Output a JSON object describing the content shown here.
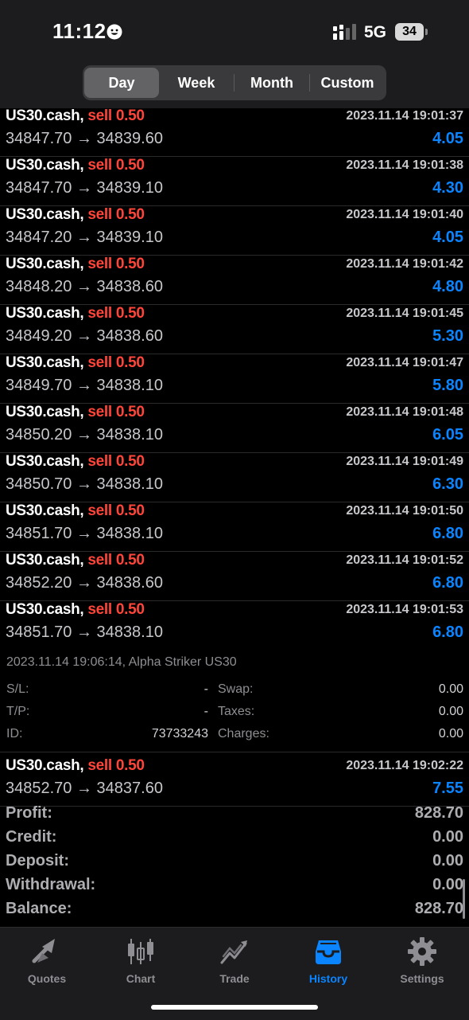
{
  "status_bar": {
    "time": "11:12",
    "network": "5G",
    "battery": "34"
  },
  "tabs": [
    {
      "label": "Day",
      "active": true
    },
    {
      "label": "Week",
      "active": false
    },
    {
      "label": "Month",
      "active": false
    },
    {
      "label": "Custom",
      "active": false
    }
  ],
  "deals": [
    {
      "symbol": "US30.cash,",
      "side": "sell 0.50",
      "time": "2023.11.14 19:01:37",
      "prices": "34847.70 → 34839.60",
      "profit": "4.05"
    },
    {
      "symbol": "US30.cash,",
      "side": "sell 0.50",
      "time": "2023.11.14 19:01:38",
      "prices": "34847.70 → 34839.10",
      "profit": "4.30"
    },
    {
      "symbol": "US30.cash,",
      "side": "sell 0.50",
      "time": "2023.11.14 19:01:40",
      "prices": "34847.20 → 34839.10",
      "profit": "4.05"
    },
    {
      "symbol": "US30.cash,",
      "side": "sell 0.50",
      "time": "2023.11.14 19:01:42",
      "prices": "34848.20 → 34838.60",
      "profit": "4.80"
    },
    {
      "symbol": "US30.cash,",
      "side": "sell 0.50",
      "time": "2023.11.14 19:01:45",
      "prices": "34849.20 → 34838.60",
      "profit": "5.30"
    },
    {
      "symbol": "US30.cash,",
      "side": "sell 0.50",
      "time": "2023.11.14 19:01:47",
      "prices": "34849.70 → 34838.10",
      "profit": "5.80"
    },
    {
      "symbol": "US30.cash,",
      "side": "sell 0.50",
      "time": "2023.11.14 19:01:48",
      "prices": "34850.20 → 34838.10",
      "profit": "6.05"
    },
    {
      "symbol": "US30.cash,",
      "side": "sell 0.50",
      "time": "2023.11.14 19:01:49",
      "prices": "34850.70 → 34838.10",
      "profit": "6.30"
    },
    {
      "symbol": "US30.cash,",
      "side": "sell 0.50",
      "time": "2023.11.14 19:01:50",
      "prices": "34851.70 → 34838.10",
      "profit": "6.80"
    },
    {
      "symbol": "US30.cash,",
      "side": "sell 0.50",
      "time": "2023.11.14 19:01:52",
      "prices": "34852.20 → 34838.60",
      "profit": "6.80"
    },
    {
      "symbol": "US30.cash,",
      "side": "sell 0.50",
      "time": "2023.11.14 19:01:53",
      "prices": "34851.70 → 34838.10",
      "profit": "6.80"
    }
  ],
  "details": {
    "line": "2023.11.14 19:06:14, Alpha Striker US30",
    "sl_label": "S/L:",
    "sl_value": "-",
    "tp_label": "T/P:",
    "tp_value": "-",
    "id_label": "ID:",
    "id_value": "73733243",
    "swap_label": "Swap:",
    "swap_value": "0.00",
    "taxes_label": "Taxes:",
    "taxes_value": "0.00",
    "charges_label": "Charges:",
    "charges_value": "0.00"
  },
  "last_deal": {
    "symbol": "US30.cash,",
    "side": "sell 0.50",
    "time": "2023.11.14 19:02:22",
    "prices": "34852.70 → 34837.60",
    "profit": "7.55"
  },
  "summary": {
    "profit_label": "Profit:",
    "profit": "828.70",
    "credit_label": "Credit:",
    "credit": "0.00",
    "deposit_label": "Deposit:",
    "deposit": "0.00",
    "withdrawal_label": "Withdrawal:",
    "withdrawal": "0.00",
    "balance_label": "Balance:",
    "balance": "828.70"
  },
  "tabbar": [
    {
      "label": "Quotes",
      "icon": "quotes-icon"
    },
    {
      "label": "Chart",
      "icon": "chart-icon"
    },
    {
      "label": "Trade",
      "icon": "trade-icon"
    },
    {
      "label": "History",
      "icon": "history-icon",
      "active": true
    },
    {
      "label": "Settings",
      "icon": "gear-icon"
    }
  ],
  "colors": {
    "sell": "#ff453a",
    "profit": "#0a84ff",
    "active_tab": "#0a84ff"
  }
}
